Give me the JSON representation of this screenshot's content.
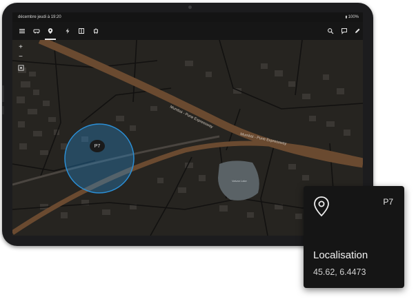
{
  "statusbar": {
    "datetime": "décembre jeudi à 19:20",
    "battery": "100%"
  },
  "toolbar": {
    "left_icons": [
      "menu-icon",
      "car-icon",
      "map-pin-icon",
      "bolt-icon",
      "panel-icon",
      "robot-icon"
    ],
    "right_icons": [
      "search-icon",
      "message-icon",
      "edit-icon"
    ],
    "active_tab": "map-pin-icon"
  },
  "map": {
    "zoom_in": "+",
    "zoom_out": "−",
    "road_labels": [
      "Mumbai - Pune Expressway",
      "Mumbai - Pune Expressway"
    ],
    "lake_label": "Valvan Lake",
    "marker": {
      "code": "P7"
    }
  },
  "colors": {
    "map_background": "#262420",
    "expressway": "#6a4a30",
    "geofence": "#2b8fd6",
    "card_background": "#151515"
  },
  "card": {
    "code": "P7",
    "title": "Localisation",
    "coordinates": "45.62, 6.4473",
    "icon": "location-pin-icon"
  }
}
